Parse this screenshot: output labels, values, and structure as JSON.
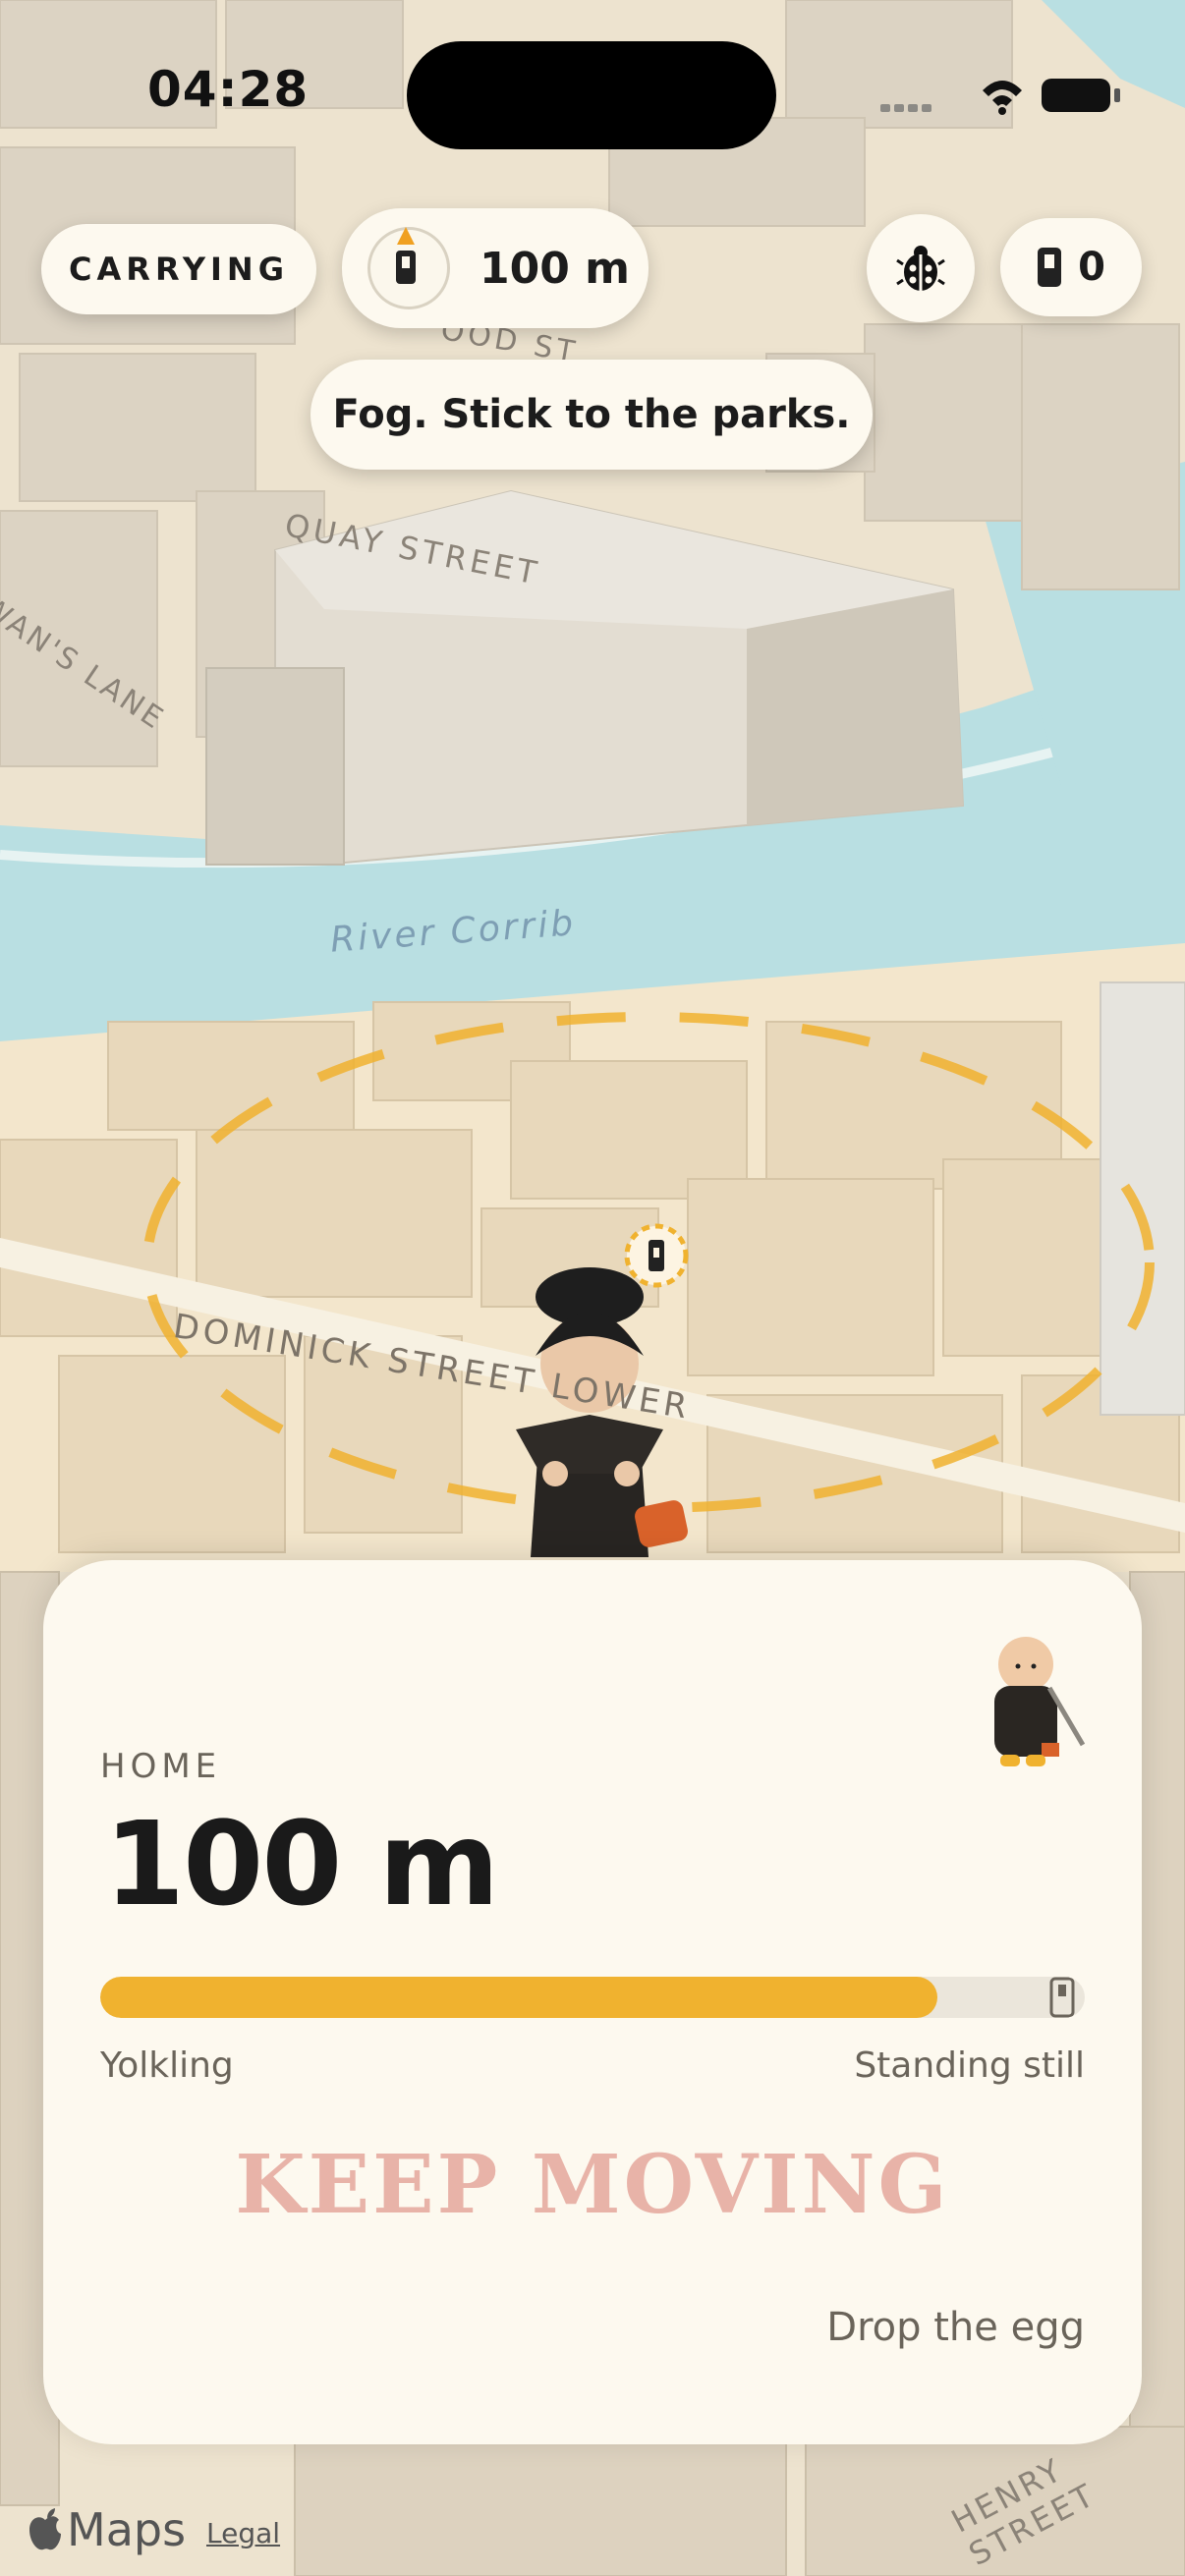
{
  "status_bar": {
    "time": "04:28"
  },
  "top_bar": {
    "carrying_label": "CARRYING",
    "distance_value": "100 m",
    "egg_count": "0"
  },
  "banner": {
    "message": "Fog. Stick to the parks."
  },
  "map": {
    "labels": {
      "street_top": "OOD ST",
      "quay_street": "QUAY STREET",
      "swans_lane": "WAN'S LANE",
      "river": "River Corrib",
      "dominick_street": "DOMINICK STREET LOWER",
      "henry_street": "HENRY STREET"
    },
    "colors": {
      "water": "#b9dfe2",
      "ground": "#ede3cf",
      "building": "#dcd3c3",
      "accent": "#f0b22f"
    }
  },
  "card": {
    "home_label": "HOME",
    "distance": "100 m",
    "progress": 0.85,
    "progress_left_label": "Yolkling",
    "progress_right_label": "Standing still",
    "keep_moving": "KEEP MOVING",
    "drop_egg_label": "Drop the egg"
  },
  "footer": {
    "maps_label": "Maps",
    "legal_label": "Legal"
  },
  "icons": [
    "compass-icon",
    "ladybug-icon",
    "egg-icon",
    "apple-icon",
    "wifi-icon",
    "battery-icon"
  ]
}
